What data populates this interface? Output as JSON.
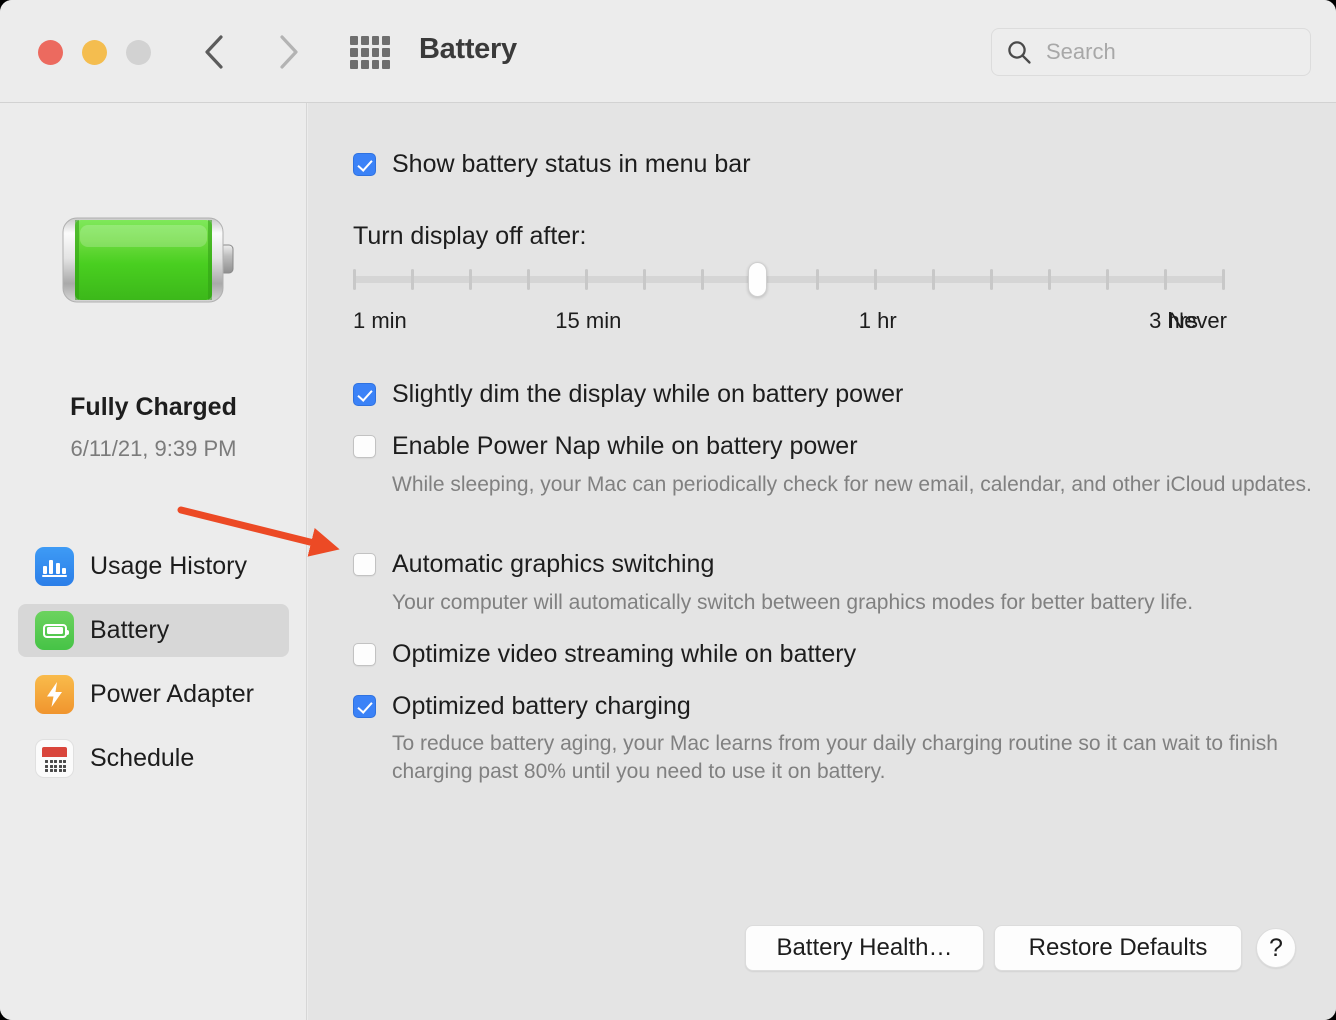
{
  "window": {
    "title": "Battery",
    "traffic_lights": [
      "close",
      "minimize",
      "zoom"
    ],
    "colors": {
      "close": "#ec6a5f",
      "minimize": "#f4bd4f",
      "zoom": "#d2d2d2",
      "accent": "#3b82f7",
      "annotation": "#ec4a25",
      "battery_green": "#52d22a"
    }
  },
  "toolbar": {
    "back_icon": "chevron-left-icon",
    "forward_icon": "chevron-right-icon",
    "show_all_icon": "grid-icon",
    "title": "Battery",
    "search": {
      "placeholder": "Search",
      "value": "",
      "icon": "search-icon"
    }
  },
  "sidebar": {
    "battery_graphic": "battery-full-icon",
    "status_title": "Fully Charged",
    "status_subtitle": "6/11/21, 9:39 PM",
    "items": [
      {
        "label": "Usage History",
        "icon": "bar-chart-icon",
        "selected": false
      },
      {
        "label": "Battery",
        "icon": "battery-icon",
        "selected": true
      },
      {
        "label": "Power Adapter",
        "icon": "bolt-icon",
        "selected": false
      },
      {
        "label": "Schedule",
        "icon": "calendar-icon",
        "selected": false
      }
    ]
  },
  "main": {
    "show_battery_status": {
      "label": "Show battery status in menu bar",
      "checked": true
    },
    "display_off": {
      "label": "Turn display off after:",
      "slider": {
        "value_position_percent": 46.4,
        "tick_count": 16,
        "tick_labels": [
          {
            "text": "1 min",
            "percent": 0
          },
          {
            "text": "15 min",
            "percent": 23.2
          },
          {
            "text": "1 hr",
            "percent": 58.0
          },
          {
            "text": "3 hrs",
            "percent": 91.3
          },
          {
            "text": "Never",
            "percent": 100
          }
        ]
      }
    },
    "options": [
      {
        "label": "Slightly dim the display while on battery power",
        "checked": true,
        "description": ""
      },
      {
        "label": "Enable Power Nap while on battery power",
        "checked": false,
        "description": "While sleeping, your Mac can periodically check for new email, calendar, and other iCloud updates."
      },
      {
        "label": "Automatic graphics switching",
        "checked": false,
        "description": "Your computer will automatically switch between graphics modes for better battery life."
      },
      {
        "label": "Optimize video streaming while on battery",
        "checked": false,
        "description": ""
      },
      {
        "label": "Optimized battery charging",
        "checked": true,
        "description": "To reduce battery aging, your Mac learns from your daily charging routine so it can wait to finish charging past 80% until you need to use it on battery."
      }
    ],
    "buttons": {
      "battery_health": "Battery Health…",
      "restore_defaults": "Restore Defaults",
      "help": "?"
    }
  },
  "annotation": {
    "type": "arrow",
    "color": "#ec4a25",
    "points_to": "Automatic graphics switching"
  }
}
